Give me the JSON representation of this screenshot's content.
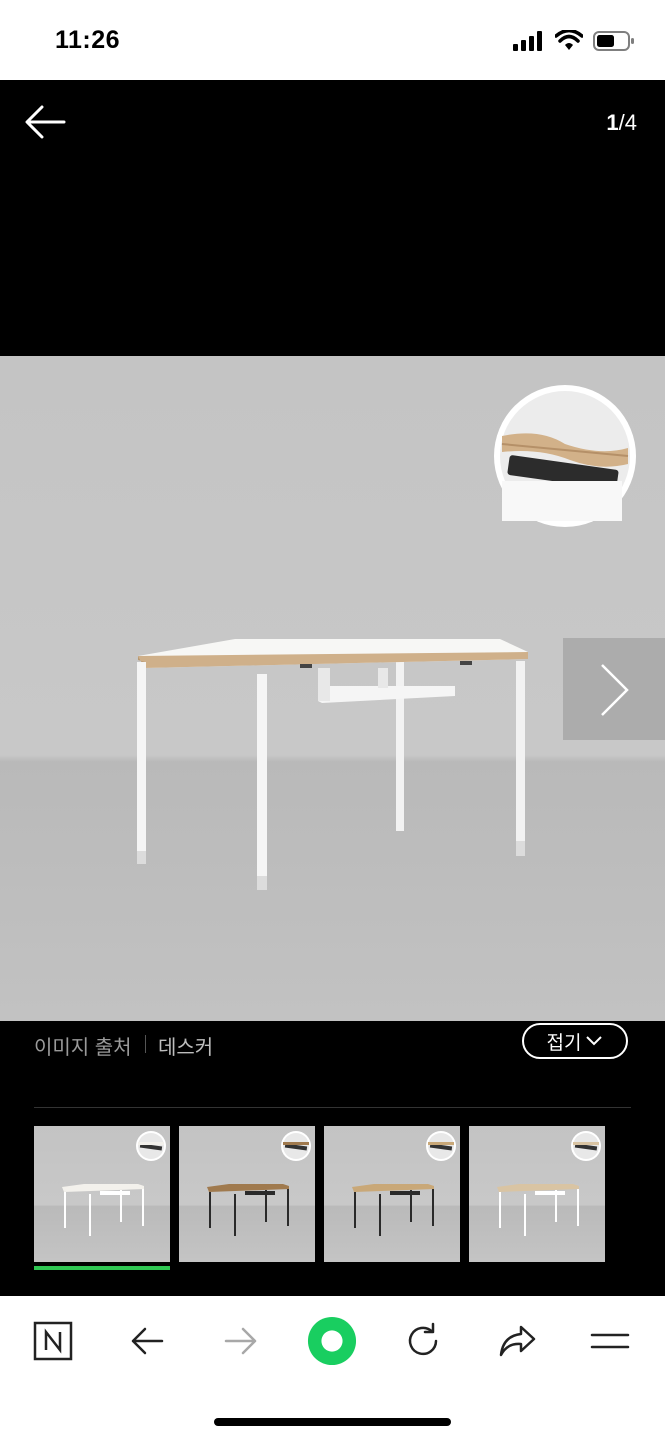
{
  "status_bar": {
    "time": "11:26"
  },
  "viewer": {
    "current_page": "1",
    "page_separator": "/",
    "total_pages": "4"
  },
  "caption": {
    "source_label": "이미지 출처",
    "source_value": "데스커",
    "collapse_label": "접기"
  },
  "thumbnails": [
    {
      "frame_color": "#ffffff",
      "top_color": "#f3f1ec",
      "selected": true
    },
    {
      "frame_color": "#2a2a2a",
      "top_color": "#a07a4e",
      "selected": false
    },
    {
      "frame_color": "#2a2a2a",
      "top_color": "#c9a878",
      "selected": false
    },
    {
      "frame_color": "#ffffff",
      "top_color": "#d9c4a3",
      "selected": false
    }
  ],
  "colors": {
    "accent": "#2fc652",
    "toolbar_accent": "#19ce60"
  },
  "toolbar": {
    "icons": [
      "naver-n-icon",
      "back-arrow-icon",
      "forward-arrow-icon",
      "green-dot-icon",
      "refresh-icon",
      "share-icon",
      "menu-icon"
    ]
  }
}
